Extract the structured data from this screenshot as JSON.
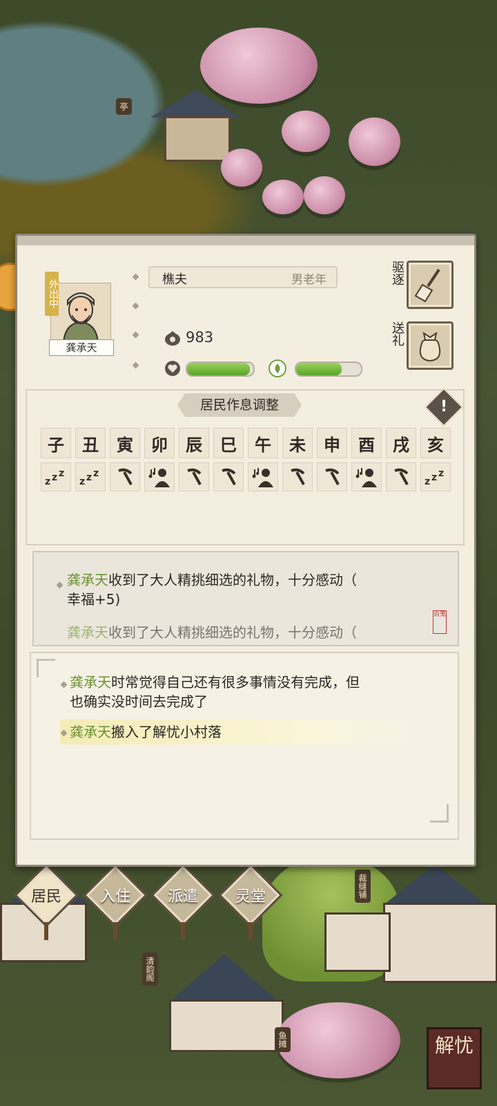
{
  "resident": {
    "status_tag": "外出中",
    "name": "龚承天",
    "occupation": "樵夫",
    "attributes": "男老年",
    "money": "983",
    "health_fraction": 0.95,
    "happiness_fraction": 0.7
  },
  "actions": {
    "expel_label": "驱逐",
    "gift_label": "送礼"
  },
  "schedule": {
    "title": "居民作息调整",
    "hours": [
      "子",
      "丑",
      "寅",
      "卯",
      "辰",
      "巳",
      "午",
      "未",
      "申",
      "酉",
      "戌",
      "亥"
    ],
    "activities": [
      "sleep",
      "sleep",
      "work",
      "leisure",
      "work",
      "work",
      "leisure",
      "work",
      "work",
      "leisure",
      "work",
      "sleep"
    ]
  },
  "log_recent": {
    "name1": "龚承天",
    "text1a": "收到了大人精挑细选的礼物，十分感动（",
    "text1b": "幸福+5)",
    "name2": "龚承天",
    "text2": "收到了大人精挑细选的礼物，十分感动（"
  },
  "log_thoughts": {
    "name1": "龚承天",
    "text1a": "时常觉得自己还有很多事情没有完成，但",
    "text1b": "也确实没时间去完成了",
    "name2": "龚承天",
    "text2": "搬入了解忧小村落"
  },
  "tabs": [
    "居民",
    "入住",
    "派遣",
    "灵堂"
  ],
  "active_tab": "居民",
  "world_signs": {
    "pavilion": "亭",
    "sign_a": "清韵阁",
    "sign_b": "裁缝铺",
    "sign_c": "鱼摊",
    "seal_small": "百鬼",
    "corner_seal": "解忧"
  }
}
